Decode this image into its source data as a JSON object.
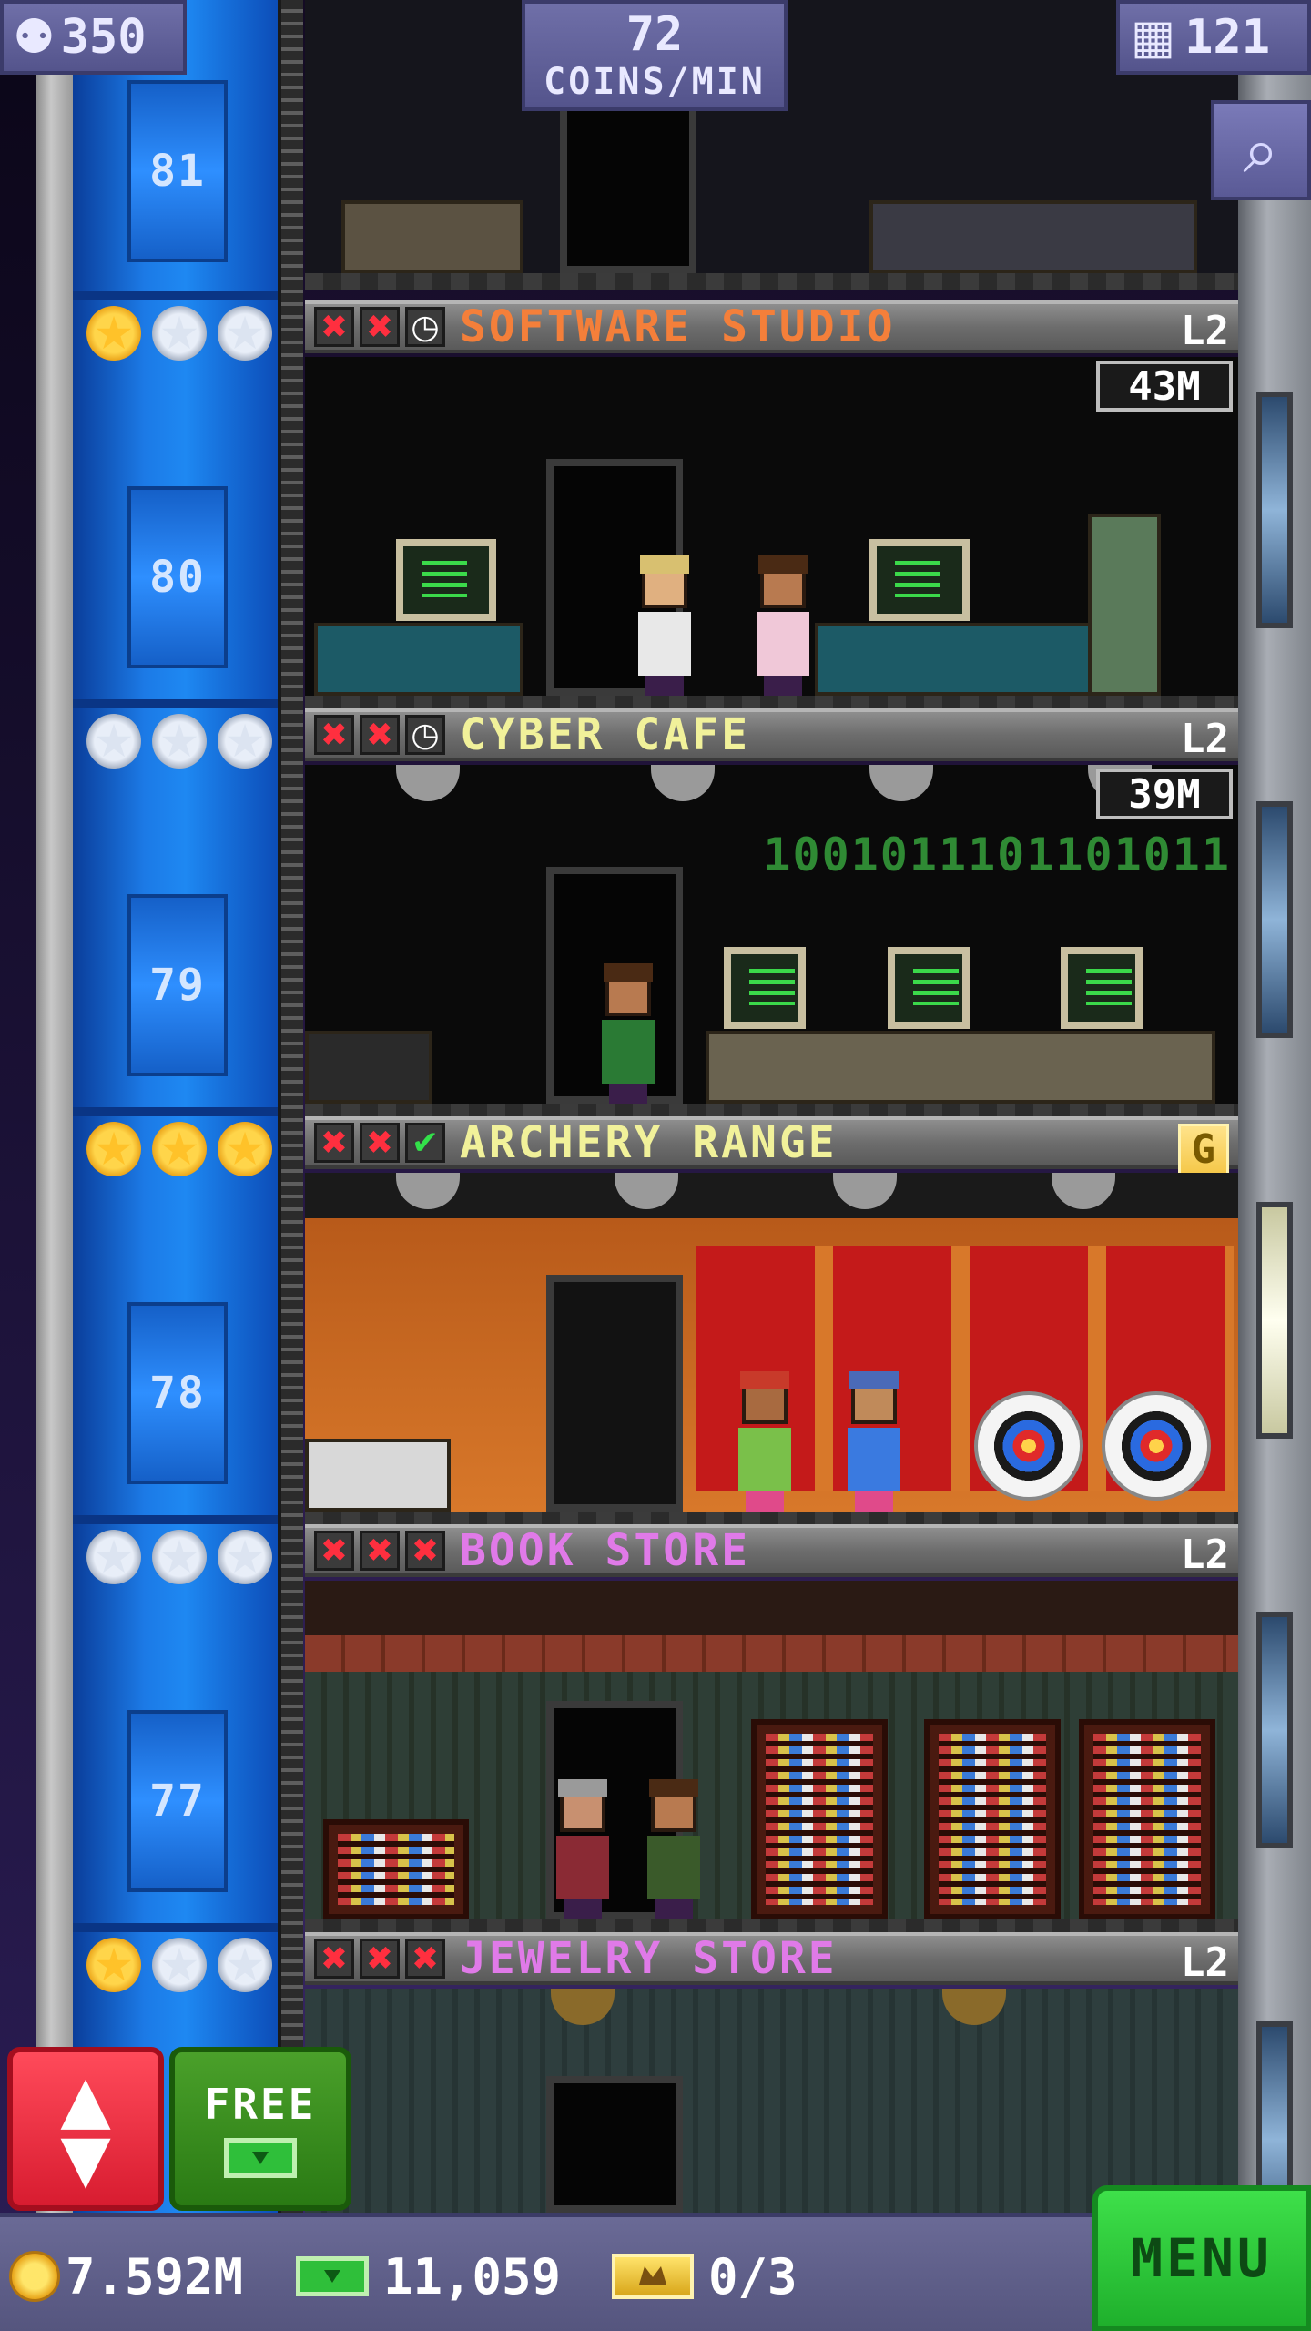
{
  "hud": {
    "population": "350",
    "coin_rate": "72",
    "coin_rate_unit": "COINS/MIN",
    "floor_count": "121",
    "zoom_icon": "magnifier-icon"
  },
  "shaft_floors": [
    {
      "number": "81"
    },
    {
      "number": "80"
    },
    {
      "number": "79"
    },
    {
      "number": "78"
    },
    {
      "number": "77"
    }
  ],
  "rooms": [
    {
      "name": "SOFTWARE STUDIO",
      "name_color": "#f47f3a",
      "level": "L2",
      "stars": [
        true,
        false,
        false
      ],
      "status": [
        "x",
        "x",
        "clock"
      ],
      "restock_time": "43M"
    },
    {
      "name": "CYBER CAFE",
      "name_color": "#f1f19a",
      "level": "L2",
      "stars": [
        false,
        false,
        false
      ],
      "status": [
        "x",
        "x",
        "clock"
      ],
      "restock_time": "39M",
      "decor_text": "1001011101101011"
    },
    {
      "name": "ARCHERY RANGE",
      "name_color": "#f1f19a",
      "level": "G",
      "stars": [
        true,
        true,
        true
      ],
      "status": [
        "x",
        "x",
        "check"
      ]
    },
    {
      "name": "BOOK STORE",
      "name_color": "#e07ae8",
      "level": "L2",
      "stars": [
        false,
        false,
        false
      ],
      "status": [
        "x",
        "x",
        "x"
      ]
    },
    {
      "name": "JEWELRY STORE",
      "name_color": "#e07ae8",
      "level": "L2",
      "stars": [
        true,
        false,
        false
      ],
      "status": [
        "x",
        "x",
        "x"
      ]
    }
  ],
  "buttons": {
    "elevator_icon": "up-down-arrows-icon",
    "free_label": "FREE",
    "menu_label": "MENU"
  },
  "bottom_bar": {
    "coins": "7.592M",
    "bux": "11,059",
    "vip": "0/3"
  },
  "colors": {
    "shaft_blue": "#1e88f2",
    "elevator_red": "#e02a3a",
    "menu_green": "#2fd03c"
  }
}
